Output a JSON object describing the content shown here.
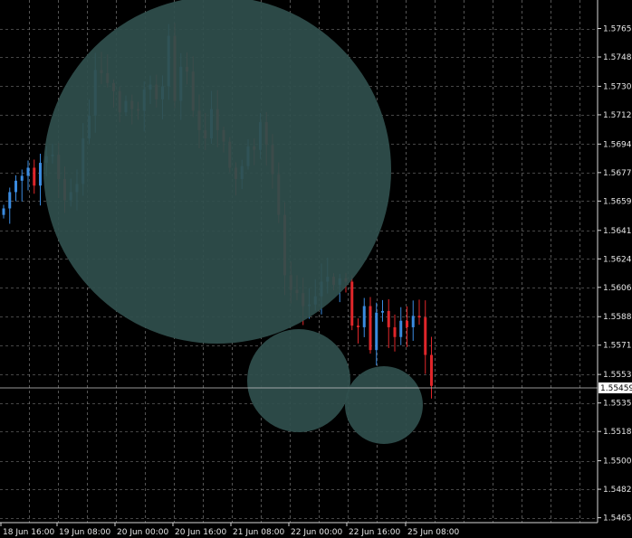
{
  "colors": {
    "background": "#000000",
    "grid": "#8c8c8c",
    "axis": "#d9d9d9",
    "bull": "#3a8be0",
    "bear": "#e0262a",
    "bubble": "#2f4f4c",
    "label_text": "#e6e6e6",
    "current_line": "#c8c8c8"
  },
  "chart_data": {
    "type": "candlestick",
    "title": "",
    "xlabel": "",
    "ylabel": "",
    "ylim": [
      1.5462,
      1.5783
    ],
    "y_ticks": [
      "1.57655",
      "1.57480",
      "1.57300",
      "1.57125",
      "1.56945",
      "1.56770",
      "1.56595",
      "1.56415",
      "1.56240",
      "1.56065",
      "1.55885",
      "1.55710",
      "1.55530",
      "1.55355",
      "1.55180",
      "1.55000",
      "1.54825",
      "1.54650"
    ],
    "x_ticks": [
      "18 Jun 16:00",
      "19 Jun 08:00",
      "20 Jun 00:00",
      "20 Jun 16:00",
      "21 Jun 08:00",
      "22 Jun 00:00",
      "22 Jun 16:00",
      "25 Jun 08:00"
    ],
    "current_price": "1.55459",
    "grid": true,
    "overlay": "translucent circles",
    "series": [
      {
        "kind": "close",
        "values": [
          1.5655,
          1.5665,
          1.5672,
          1.5675,
          1.568,
          1.5669,
          1.5683,
          1.5687,
          1.5688,
          1.5673,
          1.566,
          1.5665,
          1.567,
          1.5698,
          1.5712,
          1.574,
          1.5738,
          1.5732,
          1.5727,
          1.5714,
          1.5721,
          1.5716,
          1.5715,
          1.5728,
          1.5731,
          1.5722,
          1.573,
          1.5761,
          1.5721,
          1.5742,
          1.5739,
          1.5715,
          1.5703,
          1.5698,
          1.5716,
          1.5703,
          1.5696,
          1.568,
          1.5673,
          1.5681,
          1.5693,
          1.5691,
          1.5708,
          1.5694,
          1.5676,
          1.5651,
          1.5614,
          1.5605,
          1.5603,
          1.5595,
          1.5596,
          1.5601,
          1.561,
          1.5613,
          1.5608,
          1.5612,
          1.561,
          1.5583,
          1.5582,
          1.5595,
          1.5568,
          1.5591,
          1.5592,
          1.5582,
          1.5576,
          1.5586,
          1.5582,
          1.5589,
          1.5588,
          1.5565,
          1.5546
        ]
      }
    ]
  }
}
